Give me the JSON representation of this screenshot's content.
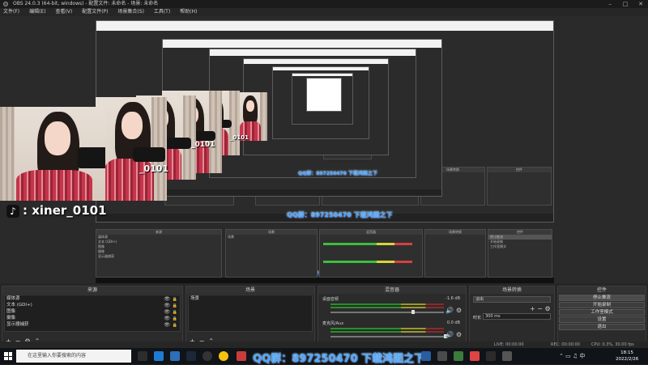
{
  "window": {
    "title": "OBS 24.0.3 (64-bit, windows) - 配置文件: 未命名 - 场景: 未命名"
  },
  "menu": {
    "items": [
      "文件(F)",
      "编辑(E)",
      "查看(V)",
      "配置文件(P)",
      "场景集合(S)",
      "工具(T)",
      "帮助(H)"
    ]
  },
  "overlay": {
    "tiktok_id": ": xiner_0101",
    "cam_label": "_0101",
    "qq_watermark": "QQ群：897250470  下载鸿图之下"
  },
  "docks": {
    "sources": {
      "title": "来源",
      "items": [
        "媒体源",
        "文本 (GDI+)",
        "图像",
        "摄像",
        "显示器捕获"
      ]
    },
    "scenes": {
      "title": "场景",
      "items": [
        "场景"
      ]
    },
    "mixer": {
      "title": "混音器",
      "tracks": [
        {
          "name": "桌面音频",
          "db": "-1.6 dB"
        },
        {
          "name": "麦克风/Aux",
          "db": "0.0 dB"
        }
      ]
    },
    "transitions": {
      "title": "场景转换",
      "type": "淡出",
      "duration_label": "时长",
      "duration_value": "300 ms"
    },
    "controls": {
      "title": "控件",
      "buttons": [
        "停止推流",
        "开始录制",
        "工作室模式",
        "设置",
        "退出"
      ]
    }
  },
  "status": {
    "left": "LIVE: 00:00:00",
    "rec": "REC: 00:00:00",
    "cpu": "CPU: 0.3%, 30.00 fps"
  },
  "taskbar": {
    "search_placeholder": "在这里输入你要搜索的内容",
    "clock_time": "18:15",
    "clock_date": "2022/2/26"
  },
  "colors": {
    "accent": "#4aa8ff",
    "bg": "#1e1e1e",
    "panel": "#2b2b2b"
  }
}
